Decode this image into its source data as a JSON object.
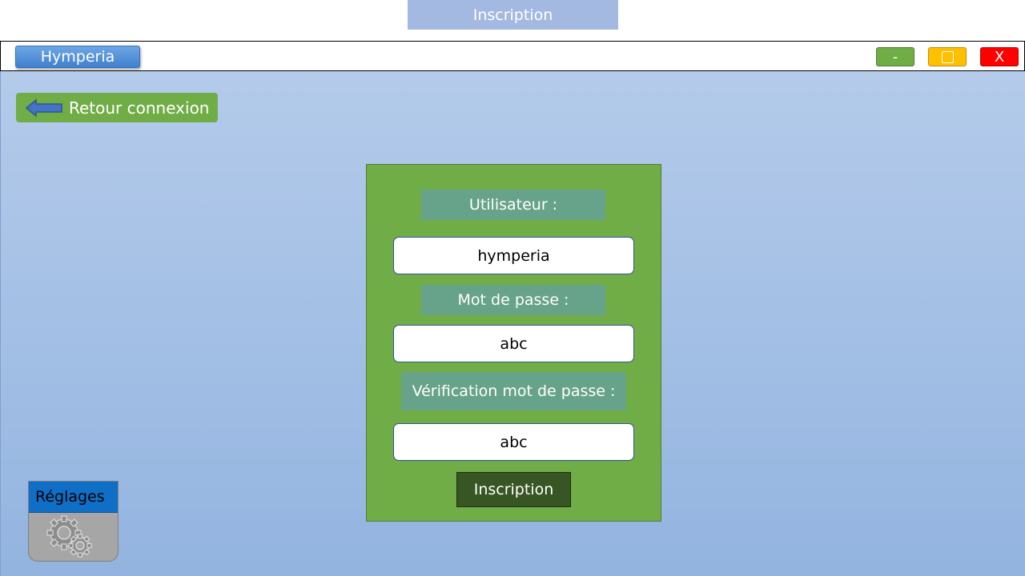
{
  "page": {
    "title": "Inscription"
  },
  "app": {
    "name": "Hymperia",
    "window_controls": {
      "minimize": "-",
      "close": "X"
    }
  },
  "back": {
    "label": "Retour connexion",
    "icon": "arrow-left-icon"
  },
  "form": {
    "user_label": "Utilisateur :",
    "user_value": "hymperia",
    "password_label": "Mot de passe :",
    "password_value": "abc",
    "verify_label": "Vérification mot de passe :",
    "verify_value": "abc",
    "submit_label": "Inscription"
  },
  "settings": {
    "label": "Réglages",
    "icon": "gears-icon"
  },
  "colors": {
    "accent_green": "#70ad47",
    "dark_green": "#375623",
    "blue": "#0f6fc6",
    "close_red": "#ff0000",
    "maximize_yellow": "#ffc000"
  }
}
